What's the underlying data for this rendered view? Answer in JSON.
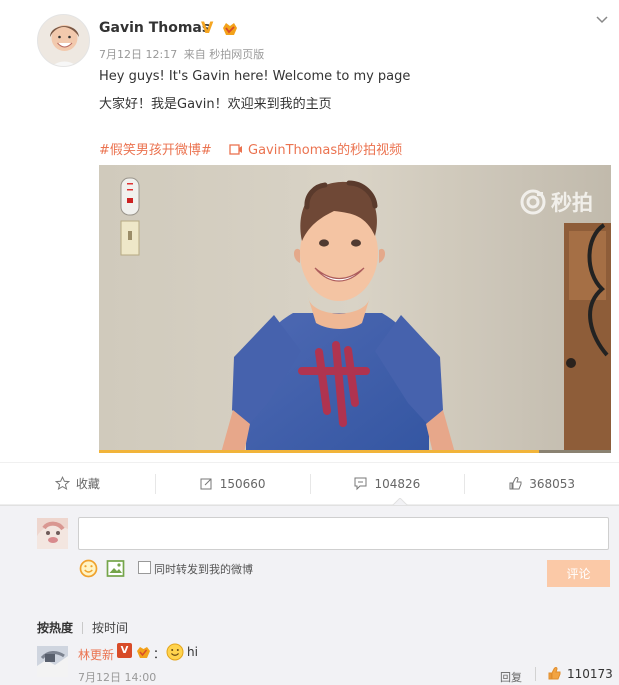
{
  "post": {
    "username": "Gavin Thomas",
    "verified_mark": "V",
    "meta": {
      "date": "7月12日 12:17",
      "source": "来自 秒拍网页版"
    },
    "text_lines": [
      "Hey guys! It's Gavin here! Welcome to my page",
      "大家好！我是Gavin！欢迎来到我的主页"
    ],
    "topic": "#假笑男孩开微博#",
    "video_link": "GavinThomas的秒拍视频",
    "video": {
      "watermark": "秒拍",
      "progress_fraction": 0.86
    }
  },
  "actions": {
    "favorite": "收藏",
    "repost_count": "150660",
    "comment_count": "104826",
    "like_count": "368053"
  },
  "comment_box": {
    "input_value": "",
    "repost_checkbox_label": "同时转发到我的微博",
    "submit_label": "评论",
    "sort_hot": "按热度",
    "sort_time": "按时间"
  },
  "comments": [
    {
      "user": "林更新",
      "verified_mark": "V",
      "separator": "：",
      "text": "hi",
      "time": "7月12日 14:00",
      "reply_label": "回复",
      "like_count": "110173"
    }
  ],
  "icons": {
    "chevron": "chevron-down-icon",
    "favorite": "star-icon",
    "repost": "repost-icon",
    "comment": "comment-icon",
    "like": "thumbs-up-icon",
    "emoji": "smile-icon",
    "image": "image-icon",
    "video": "video-icon"
  },
  "colors": {
    "accent": "#eb7350",
    "verified": "#f5a623",
    "submit_disabled": "#fbc9a7",
    "panel_bg": "#f2f2f5"
  }
}
